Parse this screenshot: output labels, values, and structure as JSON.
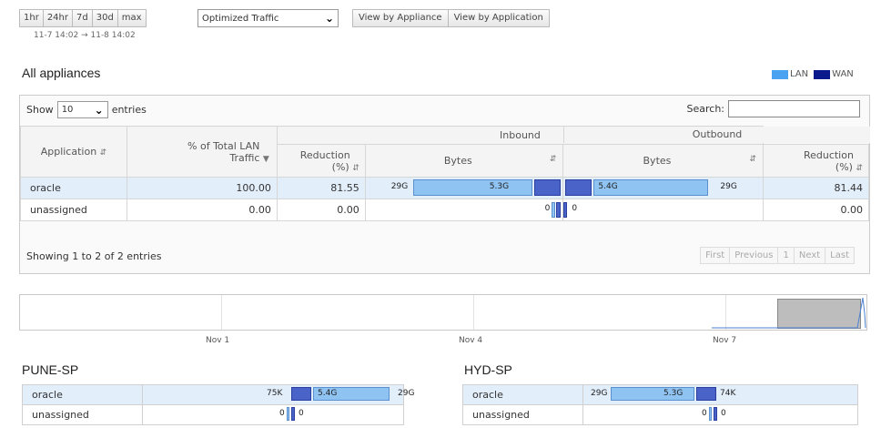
{
  "toolbar": {
    "ranges": [
      "1hr",
      "24hr",
      "7d",
      "30d",
      "max"
    ],
    "date_range": "11-7 14:02 → 11-8 14:02",
    "traffic_select": "Optimized Traffic",
    "view_buttons": [
      "View by Appliance",
      "View by Application"
    ]
  },
  "section": {
    "title": "All appliances"
  },
  "legend": {
    "lan": "LAN",
    "wan": "WAN",
    "lan_color": "#4aa3f0",
    "wan_color": "#0a1a8c"
  },
  "table_controls": {
    "show_label": "Show",
    "entries_value": "10",
    "entries_label": "entries",
    "search_label": "Search:"
  },
  "table": {
    "headers": {
      "application": "Application",
      "pct_lan": "% of Total LAN Traffic",
      "inbound": "Inbound",
      "outbound": "Outbound",
      "reduction": "Reduction (%)",
      "bytes": "Bytes"
    },
    "rows": [
      {
        "app": "oracle",
        "pct": "100.00",
        "in_red": "81.55",
        "in_wan": "29G",
        "in_lan": "5.3G",
        "out_lan": "5.4G",
        "out_wan": "29G",
        "out_red": "81.44"
      },
      {
        "app": "unassigned",
        "pct": "0.00",
        "in_red": "0.00",
        "in_zero": "0",
        "out_zero": "0",
        "out_red": "0.00"
      }
    ],
    "footer": "Showing 1 to 2 of 2 entries",
    "pager": [
      "First",
      "Previous",
      "1",
      "Next",
      "Last"
    ]
  },
  "timeline": {
    "labels": [
      "Nov 1",
      "Nov 4",
      "Nov 7"
    ]
  },
  "appliances": [
    {
      "name": "PUNE-SP",
      "rows": [
        {
          "app": "oracle",
          "left": "75K",
          "mid": "5.4G",
          "right": "29G"
        },
        {
          "app": "unassigned",
          "left": "0",
          "right": "0"
        }
      ]
    },
    {
      "name": "HYD-SP",
      "rows": [
        {
          "app": "oracle",
          "left": "29G",
          "mid": "5.3G",
          "right": "74K"
        },
        {
          "app": "unassigned",
          "left": "0",
          "right": "0"
        }
      ]
    }
  ]
}
